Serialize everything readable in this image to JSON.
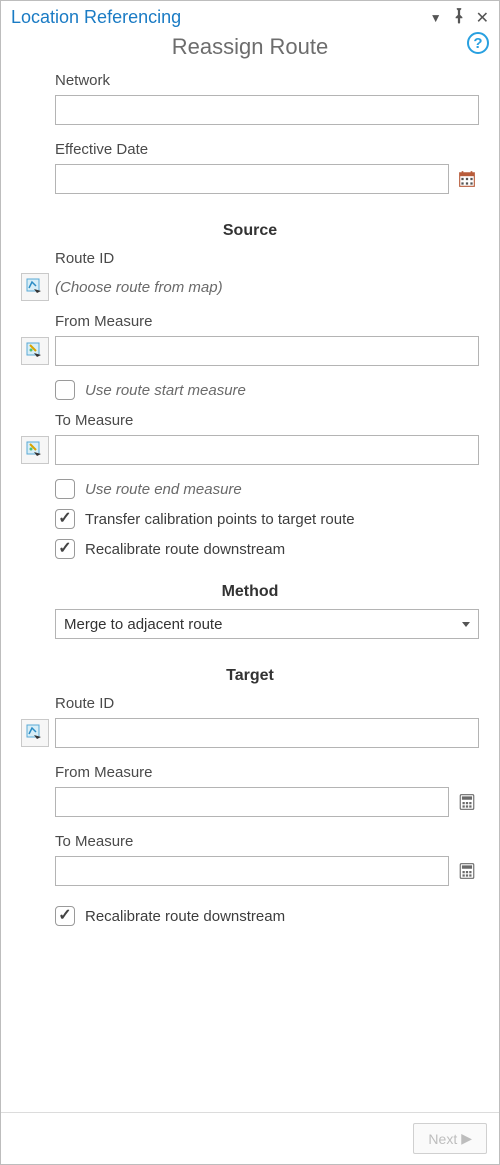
{
  "header": {
    "title": "Location Referencing",
    "subtitle": "Reassign Route"
  },
  "labels": {
    "network": "Network",
    "effective_date": "Effective Date",
    "source_head": "Source",
    "route_id": "Route ID",
    "choose_from_map": "(Choose route from map)",
    "from_measure": "From Measure",
    "use_start": "Use route start measure",
    "to_measure": "To Measure",
    "use_end": "Use route end measure",
    "transfer_calib": "Transfer calibration points to target route",
    "recalibrate": "Recalibrate route downstream",
    "method_head": "Method",
    "target_head": "Target",
    "target_from_measure": "From Measure",
    "target_to_measure": "To Measure",
    "target_recalibrate": "Recalibrate route downstream"
  },
  "values": {
    "network": "",
    "effective_date": "",
    "source_route_id": "",
    "source_from_measure": "",
    "source_to_measure": "",
    "method_selected": "Merge to adjacent route",
    "target_route_id": "",
    "target_from_measure": "",
    "target_to_measure": ""
  },
  "checks": {
    "use_start": false,
    "use_end": false,
    "transfer_calib": true,
    "source_recalibrate": true,
    "target_recalibrate": true
  },
  "footer": {
    "next": "Next"
  }
}
